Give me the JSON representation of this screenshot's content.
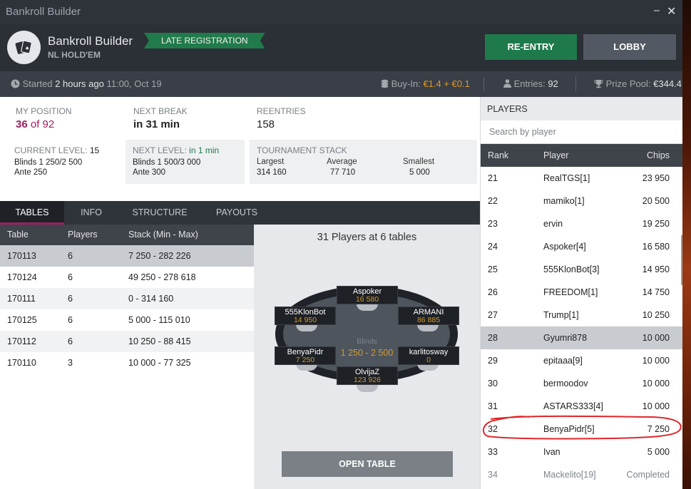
{
  "window": {
    "title": "Bankroll Builder",
    "minimize_glyph": "⎯",
    "close_glyph": "✕"
  },
  "header": {
    "name": "Bankroll Builder",
    "game": "NL HOLD'EM",
    "badge": "LATE REGISTRATION",
    "reentry_label": "RE-ENTRY",
    "lobby_label": "LOBBY"
  },
  "infobar": {
    "started_label": "Started",
    "started_ago": "2 hours ago",
    "started_time": "11:00, Oct 19",
    "buyin_label": "Buy-In:",
    "buyin_value": "€1.4 + €0.1",
    "entries_label": "Entries:",
    "entries_value": "92",
    "prize_label": "Prize Pool:",
    "prize_value": "€344.4"
  },
  "stats": {
    "position_label": "MY POSITION",
    "position_rank": "36",
    "position_total": "of 92",
    "break_label": "NEXT BREAK",
    "break_value": "in 31 min",
    "reentries_label": "REENTRIES",
    "reentries_value": "158",
    "current_level_label": "CURRENT LEVEL:",
    "current_level_value": "15",
    "current_blinds": "Blinds 1 250/2 500",
    "current_ante": "Ante 250",
    "next_level_label": "NEXT LEVEL:",
    "next_level_value": "in 1 min",
    "next_blinds": "Blinds 1 500/3 000",
    "next_ante": "Ante 300",
    "stack_label": "TOURNAMENT STACK",
    "largest_label": "Largest",
    "largest_value": "314 160",
    "average_label": "Average",
    "average_value": "77 710",
    "smallest_label": "Smallest",
    "smallest_value": "5 000"
  },
  "tabs": [
    "TABLES",
    "INFO",
    "STRUCTURE",
    "PAYOUTS"
  ],
  "tables": {
    "columns": [
      "Table",
      "Players",
      "Stack (Min - Max)"
    ],
    "rows": [
      [
        "170113",
        "6",
        "7 250 - 282 226"
      ],
      [
        "170124",
        "6",
        "49 250 - 278 618"
      ],
      [
        "170111",
        "6",
        "0 - 314 160"
      ],
      [
        "170125",
        "6",
        "5 000 - 115 010"
      ],
      [
        "170112",
        "6",
        "10 250 - 88 415"
      ],
      [
        "170110",
        "3",
        "10 000 - 77 325"
      ]
    ]
  },
  "preview": {
    "title": "31 Players at 6 tables",
    "blinds_label": "Blinds",
    "blinds_value": "1 250 - 2 500",
    "seats": [
      {
        "name": "Aspoker",
        "chips": "16 580"
      },
      {
        "name": "555KlonBot",
        "chips": "14 950"
      },
      {
        "name": "ARMANI",
        "chips": "86 885"
      },
      {
        "name": "BenyaPidr",
        "chips": "7 250"
      },
      {
        "name": "karlitosway",
        "chips": "0"
      },
      {
        "name": "OlvijaZ",
        "chips": "123 926"
      }
    ],
    "open_label": "OPEN TABLE"
  },
  "players": {
    "heading": "PLAYERS",
    "search_placeholder": "Search by player",
    "columns": [
      "Rank",
      "Player",
      "Chips"
    ],
    "rows": [
      [
        "21",
        "RealTGS[1]",
        "23 950"
      ],
      [
        "22",
        "mamiko[1]",
        "20 500"
      ],
      [
        "23",
        "ervin",
        "19 250"
      ],
      [
        "24",
        "Aspoker[4]",
        "16 580"
      ],
      [
        "25",
        "555KlonBot[3]",
        "14 950"
      ],
      [
        "26",
        "FREEDOM[1]",
        "14 750"
      ],
      [
        "27",
        "Trump[1]",
        "10 250"
      ],
      [
        "28",
        "Gyumri878",
        "10 000"
      ],
      [
        "29",
        "epitaaa[9]",
        "10 000"
      ],
      [
        "30",
        "bermoodov",
        "10 000"
      ],
      [
        "31",
        "ASTARS333[4]",
        "10 000"
      ],
      [
        "32",
        "BenyaPidr[5]",
        "7 250"
      ],
      [
        "33",
        "Ivan",
        "5 000"
      ],
      [
        "34",
        "Mackelito[19]",
        "Completed"
      ]
    ],
    "highlighted_rank": "28",
    "marked_rank": "32"
  },
  "colors": {
    "accent_green": "#1f7a4b",
    "accent_magenta": "#9b1f60",
    "gold": "#d89b2a",
    "annotation": "#e0262a"
  },
  "icons": [
    "clock-icon",
    "coins-icon",
    "person-icon",
    "trophy-icon",
    "cards-logo-icon"
  ]
}
